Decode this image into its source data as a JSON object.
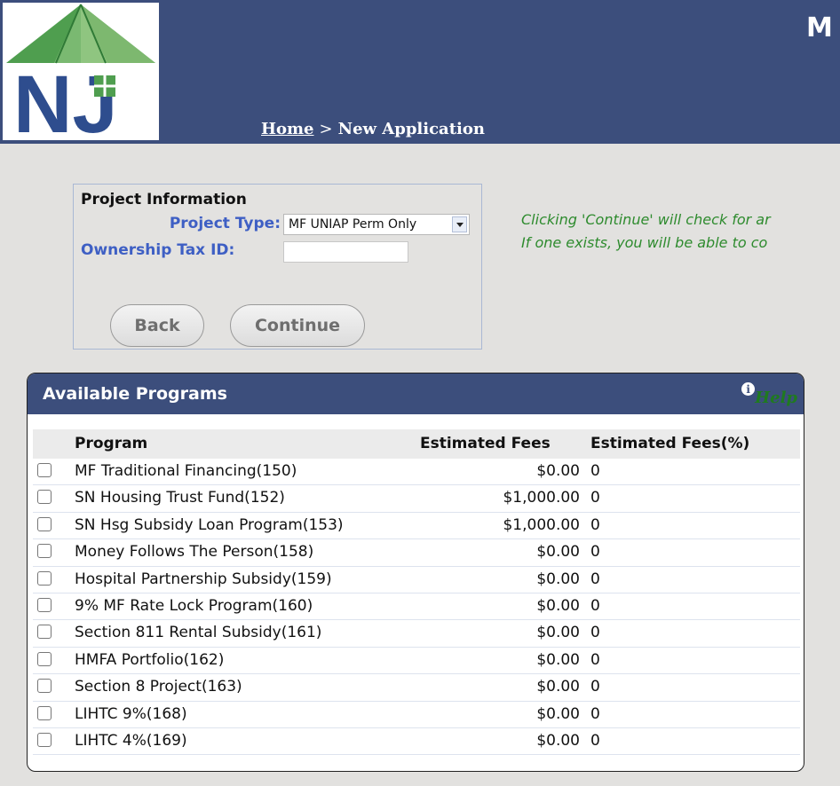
{
  "header": {
    "title": "M",
    "logo_text": "NJ",
    "breadcrumb": {
      "home": "Home",
      "separator": ">",
      "current": "New Application"
    }
  },
  "project_info": {
    "heading": "Project Information",
    "project_type_label": "Project Type:",
    "project_type_value": "MF UNIAP Perm Only",
    "tax_id_label": "Ownership Tax ID:",
    "tax_id_value": "",
    "back_label": "Back",
    "continue_label": "Continue"
  },
  "notice": {
    "line1": "Clicking 'Continue' will check for ar",
    "line2": "If one exists, you will be able to co"
  },
  "programs": {
    "title": "Available Programs",
    "help_label": "Help",
    "columns": [
      "Program",
      "Estimated Fees",
      "Estimated Fees(%)"
    ],
    "rows": [
      {
        "name": "MF Traditional Financing(150)",
        "fee": "$0.00",
        "pct": "0"
      },
      {
        "name": "SN Housing Trust Fund(152)",
        "fee": "$1,000.00",
        "pct": "0"
      },
      {
        "name": "SN Hsg Subsidy Loan Program(153)",
        "fee": "$1,000.00",
        "pct": "0"
      },
      {
        "name": "Money Follows The Person(158)",
        "fee": "$0.00",
        "pct": "0"
      },
      {
        "name": "Hospital Partnership Subsidy(159)",
        "fee": "$0.00",
        "pct": "0"
      },
      {
        "name": "9% MF Rate Lock Program(160)",
        "fee": "$0.00",
        "pct": "0"
      },
      {
        "name": "Section 811 Rental Subsidy(161)",
        "fee": "$0.00",
        "pct": "0"
      },
      {
        "name": "HMFA Portfolio(162)",
        "fee": "$0.00",
        "pct": "0"
      },
      {
        "name": "Section 8 Project(163)",
        "fee": "$0.00",
        "pct": "0"
      },
      {
        "name": "LIHTC 9%(168)",
        "fee": "$0.00",
        "pct": "0"
      },
      {
        "name": "LIHTC 4%(169)",
        "fee": "$0.00",
        "pct": "0"
      }
    ]
  }
}
